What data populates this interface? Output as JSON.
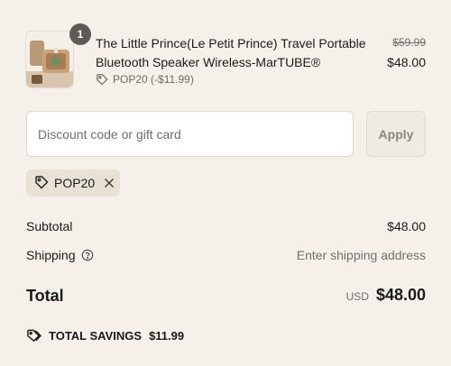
{
  "line_item": {
    "quantity": "1",
    "title": "The Little Prince(Le Petit Prince) Travel Portable Bluetooth Speaker Wireless-MarTUBE®",
    "discount_label": "POP20 (-$11.99)",
    "compare_price": "$59.99",
    "price": "$48.00"
  },
  "discount": {
    "placeholder": "Discount code or gift card",
    "value": "",
    "apply_label": "Apply",
    "applied_code": "POP20"
  },
  "summary": {
    "subtotal_label": "Subtotal",
    "subtotal_value": "$48.00",
    "shipping_label": "Shipping",
    "shipping_value": "Enter shipping address",
    "total_label": "Total",
    "currency": "USD",
    "total_value": "$48.00",
    "savings_label": "TOTAL SAVINGS",
    "savings_value": "$11.99"
  },
  "icons": {
    "tag": "tag-icon",
    "remove": "close-icon",
    "help": "question-circle-icon",
    "savings": "tags-icon"
  },
  "colors": {
    "background": "#f5f1ea",
    "chip": "#e8e2d6",
    "badge": "#5e5a55"
  }
}
